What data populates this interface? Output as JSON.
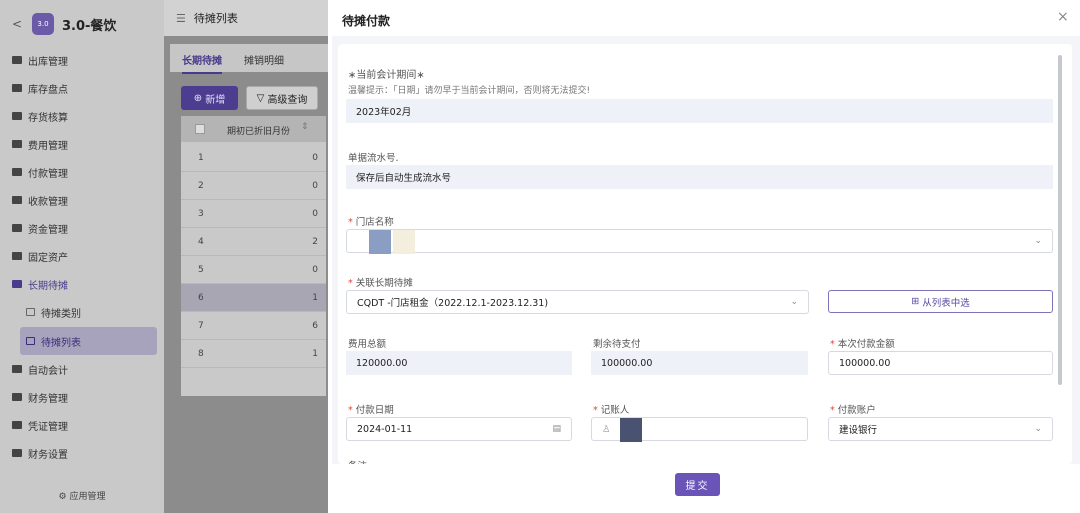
{
  "sidebar": {
    "back": "<",
    "logo": "3.0",
    "title": "3.0-餐饮",
    "items": [
      {
        "label": "出库管理"
      },
      {
        "label": "库存盘点"
      },
      {
        "label": "存货核算"
      },
      {
        "label": "费用管理"
      },
      {
        "label": "付款管理"
      },
      {
        "label": "收款管理"
      },
      {
        "label": "资金管理"
      },
      {
        "label": "固定资产"
      },
      {
        "label": "长期待摊"
      },
      {
        "label": "待摊类别"
      },
      {
        "label": "待摊列表"
      },
      {
        "label": "自动会计"
      },
      {
        "label": "财务管理"
      },
      {
        "label": "凭证管理"
      },
      {
        "label": "财务设置"
      }
    ],
    "footer": "应用管理"
  },
  "page": {
    "title": "待摊列表",
    "tabs": [
      "长期待摊",
      "摊销明细"
    ],
    "new_button": "新增",
    "advanced_search": "高级查询",
    "table": {
      "column": "期初已折旧月份",
      "rows": [
        {
          "n": "1",
          "v": "0"
        },
        {
          "n": "2",
          "v": "0"
        },
        {
          "n": "3",
          "v": "0"
        },
        {
          "n": "4",
          "v": "2"
        },
        {
          "n": "5",
          "v": "0"
        },
        {
          "n": "6",
          "v": "1"
        },
        {
          "n": "7",
          "v": "6"
        },
        {
          "n": "8",
          "v": "1"
        }
      ]
    }
  },
  "modal": {
    "title": "待摊付款",
    "close": "×",
    "period_label": "∗当前会计期间∗",
    "period_hint": "温馨提示：「日期」请勿早于当前会计期间，否则将无法提交!",
    "period_value": "2023年02月",
    "serial_label": "单据流水号.",
    "serial_value": "保存后自动生成流水号",
    "store_label": "门店名称",
    "link_label": "关联长期待摊",
    "link_value": "CQDT        -门店租金（2022.12.1-2023.12.31)",
    "list_button": "从列表中选",
    "total_label": "费用总额",
    "total_value": "120000.00",
    "remain_label": "剩余待支付",
    "remain_value": "100000.00",
    "pay_amount_label": "本次付款金额",
    "pay_amount_value": "100000.00",
    "pay_date_label": "付款日期",
    "pay_date_value": "2024-01-11",
    "recorder_label": "记账人",
    "account_label": "付款账户",
    "account_value": "建设银行",
    "notes_label": "备注",
    "submit": "提交"
  }
}
